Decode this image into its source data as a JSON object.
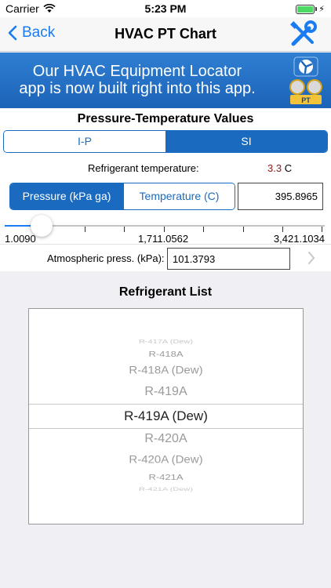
{
  "status_bar": {
    "carrier": "Carrier",
    "time": "5:23 PM",
    "battery_level": 1.0,
    "battery_color": "#4cd964",
    "charging_glyph": "⚡"
  },
  "nav": {
    "back_label": "Back",
    "title": "HVAC PT Chart",
    "tools_icon": "tools-icon"
  },
  "banner": {
    "line1": "Our HVAC Equipment Locator",
    "line2": "app is now built right into this app.",
    "badge": "PT"
  },
  "pt_section": {
    "title": "Pressure-Temperature Values",
    "units_tabs": [
      "I-P",
      "SI"
    ],
    "units_selected": "SI",
    "refrigerant_temp_label": "Refrigerant temperature:",
    "refrigerant_temp_value": "3.3",
    "refrigerant_temp_unit": "C",
    "mode_tabs": [
      "Pressure (kPa ga)",
      "Temperature (C)"
    ],
    "mode_selected": "Pressure (kPa ga)",
    "input_value": "395.8965",
    "slider_fraction": 0.116,
    "scale_min": "1.0090",
    "scale_mid": "1,711.0562",
    "scale_max": "3,421.1034",
    "atm_label": "Atmospheric press. (kPa):",
    "atm_value": "101.3793"
  },
  "refrigerant_list": {
    "title": "Refrigerant List",
    "items": [
      "R-417A (Dew)",
      "R-418A",
      "R-418A (Dew)",
      "R-419A",
      "R-419A (Dew)",
      "R-420A",
      "R-420A (Dew)",
      "R-421A",
      "R-421A (Dew)"
    ],
    "selected": "R-419A (Dew)"
  },
  "colors": {
    "accent": "#1a6bbf",
    "link": "#1a7cf0",
    "temp_value": "#8b1a1a",
    "banner": "#1c63b8"
  }
}
